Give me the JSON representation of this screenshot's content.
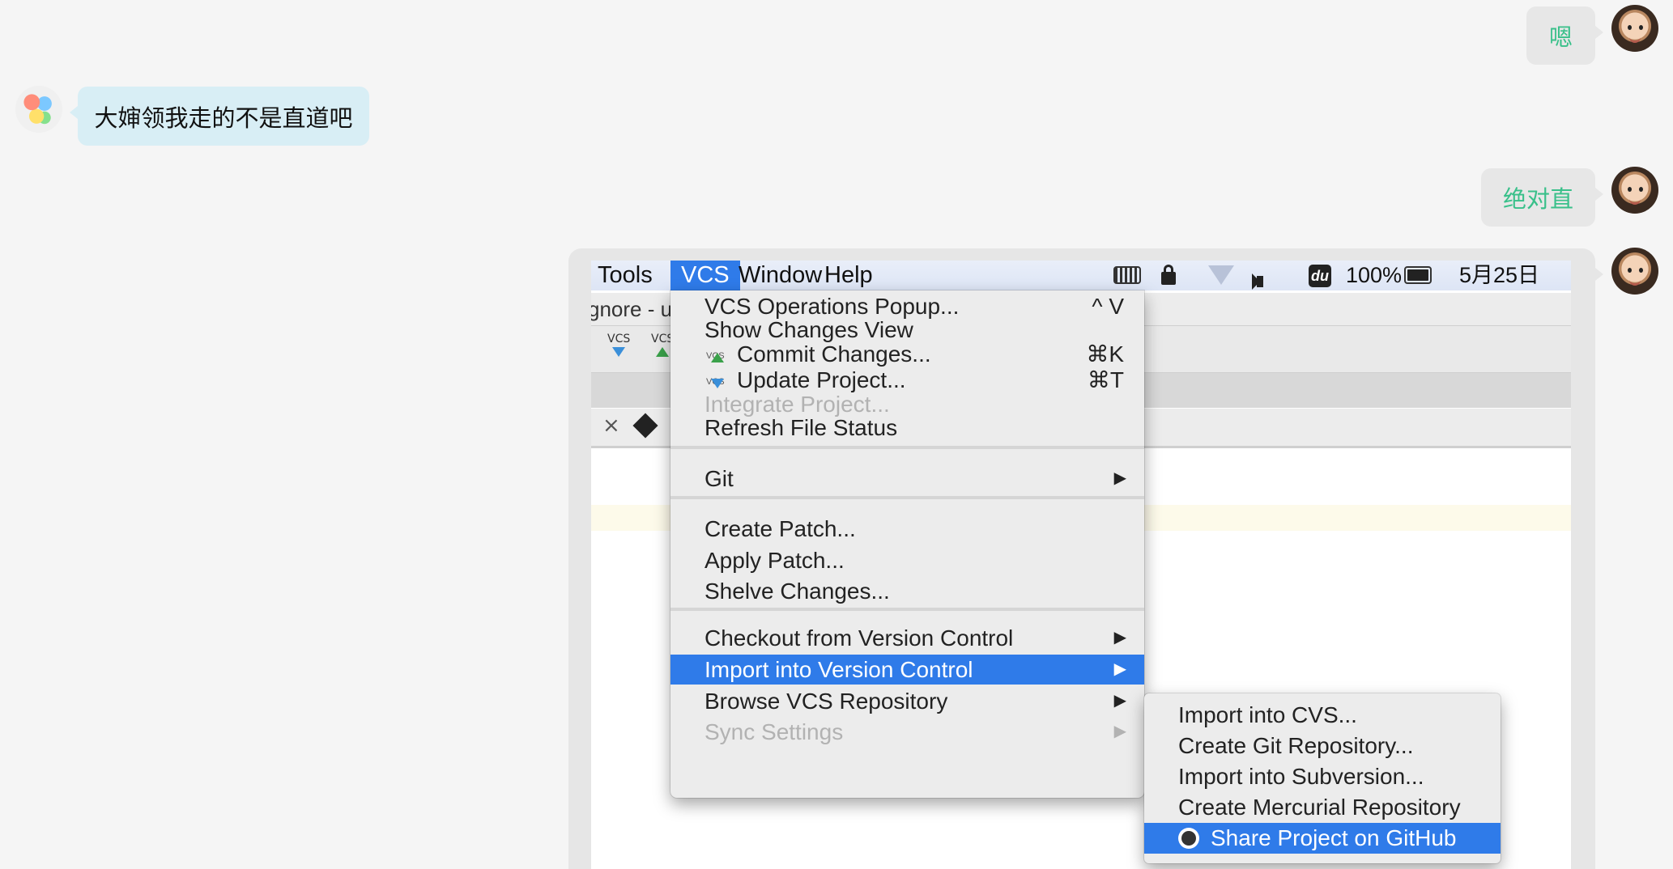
{
  "chat": {
    "msg1": "嗯",
    "msg2": "大婶领我走的不是直道吧",
    "msg3": "绝对直"
  },
  "menubar": {
    "items": [
      "Tools",
      "VCS",
      "Window",
      "Help"
    ],
    "active": "VCS",
    "status": {
      "battery_percent": "100%",
      "date": "5月25日",
      "du_label": "du"
    }
  },
  "ide": {
    "title_fragment": "gnore - u",
    "toolbar_icons": [
      "VCS",
      "VCS"
    ],
    "tab_close": "×"
  },
  "vcs_menu": {
    "items": [
      {
        "label": "VCS Operations Popup...",
        "shortcut": "^ V"
      },
      {
        "label": "Show Changes View"
      },
      {
        "label": "Commit Changes...",
        "shortcut": "⌘K",
        "icon": "vcs-commit-icon"
      },
      {
        "label": "Update Project...",
        "shortcut": "⌘T",
        "icon": "vcs-update-icon"
      },
      {
        "label": "Integrate Project...",
        "disabled": true
      },
      {
        "label": "Refresh File Status"
      },
      {
        "label": "Git",
        "submenu": true
      },
      {
        "label": "Create Patch..."
      },
      {
        "label": "Apply Patch..."
      },
      {
        "label": "Shelve Changes..."
      },
      {
        "label": "Checkout from Version Control",
        "submenu": true
      },
      {
        "label": "Import into Version Control",
        "submenu": true,
        "highlighted": true
      },
      {
        "label": "Browse VCS Repository",
        "submenu": true
      },
      {
        "label": "Sync Settings",
        "submenu": true,
        "disabled": true
      }
    ]
  },
  "import_submenu": {
    "items": [
      {
        "label": "Import into CVS..."
      },
      {
        "label": "Create Git Repository..."
      },
      {
        "label": "Import into Subversion..."
      },
      {
        "label": "Create Mercurial Repository"
      },
      {
        "label": "Share Project on GitHub",
        "icon": "github-icon",
        "highlighted": true
      }
    ]
  },
  "colors": {
    "highlight": "#2f7be9",
    "chat_green": "#39c08a",
    "left_bubble": "#d8eef5"
  }
}
